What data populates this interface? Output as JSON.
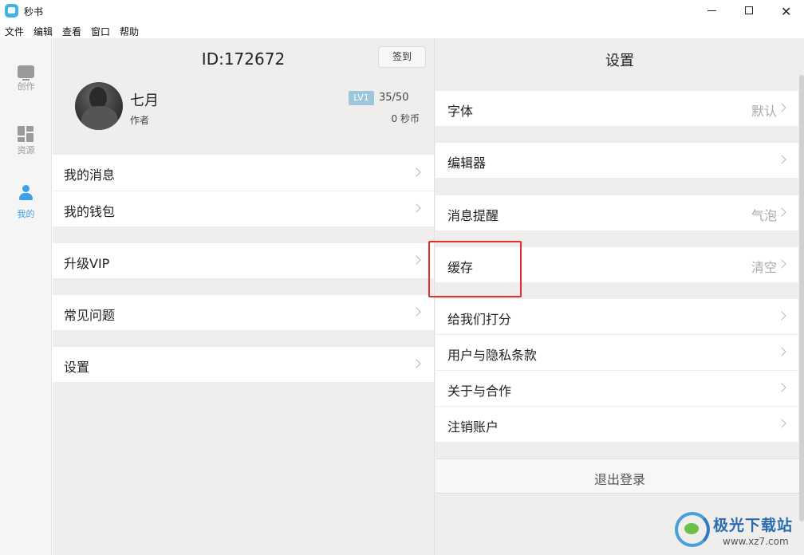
{
  "window": {
    "title": "秒书",
    "minimize": "—",
    "maximize": "☐",
    "close": "✕"
  },
  "menu": [
    "文件",
    "编辑",
    "查看",
    "窗口",
    "帮助"
  ],
  "nav": {
    "items": [
      {
        "label": "创作",
        "icon": "pen-screen-icon",
        "active": false
      },
      {
        "label": "资源",
        "icon": "grid-icon",
        "active": false
      },
      {
        "label": "我的",
        "icon": "user-icon",
        "active": true
      }
    ]
  },
  "profile": {
    "id_text": "ID:172672",
    "signin_label": "签到",
    "name": "七月",
    "role": "作者",
    "level": "LV1",
    "progress": "35/50",
    "coins": "0 秒币"
  },
  "left_menu": {
    "messages": "我的消息",
    "wallet": "我的钱包",
    "vip": "升级VIP",
    "faq": "常见问题",
    "settings": "设置"
  },
  "settings": {
    "title": "设置",
    "font": {
      "label": "字体",
      "value": "默认"
    },
    "editor": {
      "label": "编辑器",
      "value": ""
    },
    "notify": {
      "label": "消息提醒",
      "value": "气泡"
    },
    "cache": {
      "label": "缓存",
      "value": "清空"
    },
    "rate": {
      "label": "给我们打分"
    },
    "privacy": {
      "label": "用户与隐私条款"
    },
    "about": {
      "label": "关于与合作"
    },
    "deactivate": {
      "label": "注销账户"
    },
    "logout": "退出登录"
  },
  "watermark": {
    "brand": "极光下载站",
    "url": "www.xz7.com"
  },
  "colors": {
    "accent": "#3fa0e8",
    "highlight": "#e0302a",
    "level_badge": "#9cc6d9"
  }
}
